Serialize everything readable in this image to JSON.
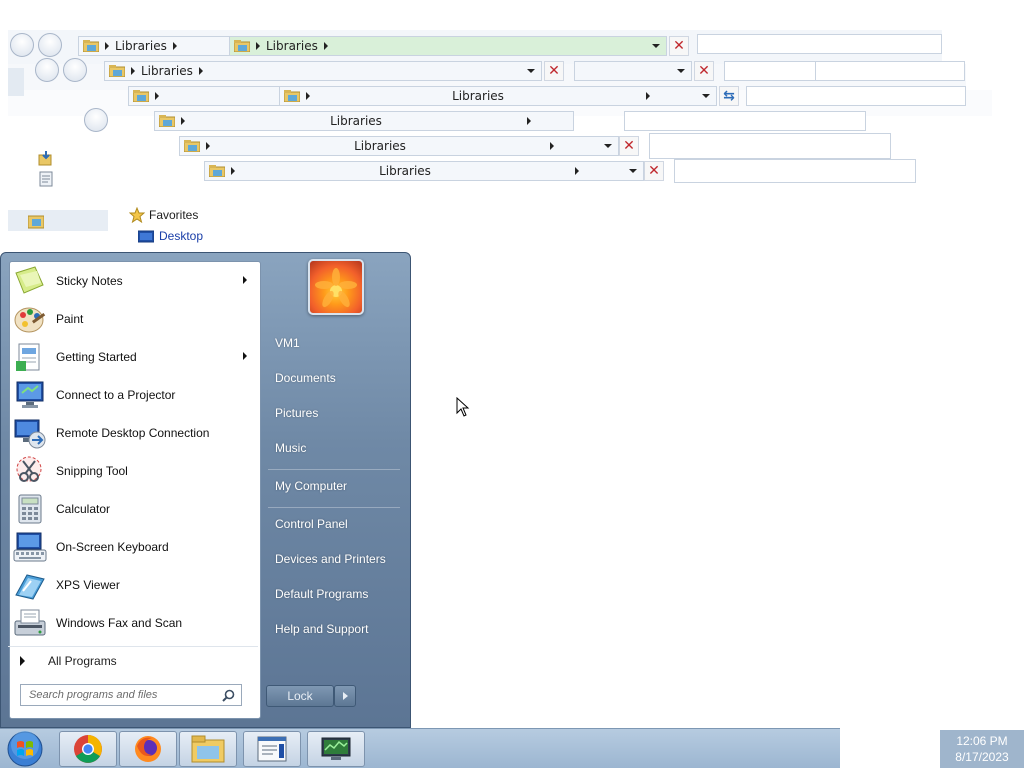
{
  "explorer": {
    "crumb_libraries": "Libraries",
    "favorites": "Favorites",
    "desktop": "Desktop"
  },
  "start_menu": {
    "programs": [
      {
        "label": "Sticky Notes",
        "has_submenu": true,
        "icon": "sticky-notes-icon"
      },
      {
        "label": "Paint",
        "has_submenu": false,
        "icon": "paint-icon"
      },
      {
        "label": "Getting Started",
        "has_submenu": true,
        "icon": "getting-started-icon"
      },
      {
        "label": "Connect to a Projector",
        "has_submenu": false,
        "icon": "projector-icon"
      },
      {
        "label": "Remote Desktop Connection",
        "has_submenu": false,
        "icon": "remote-desktop-icon"
      },
      {
        "label": "Snipping Tool",
        "has_submenu": false,
        "icon": "snipping-tool-icon"
      },
      {
        "label": "Calculator",
        "has_submenu": false,
        "icon": "calculator-icon"
      },
      {
        "label": "On-Screen Keyboard",
        "has_submenu": false,
        "icon": "keyboard-icon"
      },
      {
        "label": "XPS Viewer",
        "has_submenu": false,
        "icon": "xps-viewer-icon"
      },
      {
        "label": "Windows Fax and Scan",
        "has_submenu": false,
        "icon": "fax-scan-icon"
      }
    ],
    "all_programs": "All Programs",
    "search_placeholder": "Search programs and files",
    "right": {
      "user": "VM1",
      "documents": "Documents",
      "pictures": "Pictures",
      "music": "Music",
      "computer": "My Computer",
      "control_panel": "Control Panel",
      "devices": "Devices and Printers",
      "default_programs": "Default Programs",
      "help": "Help and Support"
    },
    "lock_label": "Lock"
  },
  "taskbar": {
    "items": [
      "chrome-icon",
      "firefox-icon",
      "explorer-icon",
      "notepad-icon",
      "system-monitor-icon"
    ]
  },
  "clock": {
    "time": "12:06 PM",
    "date": "8/17/2023"
  },
  "colors": {
    "accent": "#6f89a6",
    "close_red": "#c0282d"
  }
}
